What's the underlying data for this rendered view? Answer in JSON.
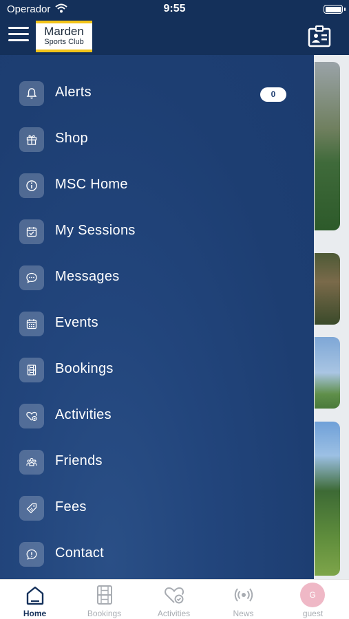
{
  "status_bar": {
    "carrier": "Operador",
    "time": "9:55"
  },
  "header": {
    "logo": {
      "title": "Marden",
      "subtitle": "Sports Club"
    }
  },
  "menu": {
    "items": [
      {
        "label": "Alerts",
        "icon": "bell-icon",
        "badge": "0"
      },
      {
        "label": "Shop",
        "icon": "gift-icon"
      },
      {
        "label": "MSC Home",
        "icon": "info-icon"
      },
      {
        "label": "My Sessions",
        "icon": "calendar-check-icon"
      },
      {
        "label": "Messages",
        "icon": "chat-bubble-icon"
      },
      {
        "label": "Events",
        "icon": "calendar-grid-icon"
      },
      {
        "label": "Bookings",
        "icon": "court-icon"
      },
      {
        "label": "Activities",
        "icon": "heart-check-icon"
      },
      {
        "label": "Friends",
        "icon": "people-icon"
      },
      {
        "label": "Fees",
        "icon": "tag-icon"
      },
      {
        "label": "Contact",
        "icon": "info-bubble-icon"
      }
    ]
  },
  "tabs": [
    {
      "label": "Home",
      "icon": "home-icon",
      "active": true
    },
    {
      "label": "Bookings",
      "icon": "court-icon",
      "active": false
    },
    {
      "label": "Activities",
      "icon": "heart-check-icon",
      "active": false
    },
    {
      "label": "News",
      "icon": "broadcast-icon",
      "active": false
    },
    {
      "label": "guest",
      "icon": "avatar",
      "avatar_initial": "G",
      "active": false
    }
  ],
  "colors": {
    "header": "#14305a",
    "drawer": "#1c3c70",
    "logo_accent": "#f2c318",
    "tab_active": "#14305a",
    "tab_inactive": "#a8acb2",
    "avatar": "#efb8c6"
  }
}
